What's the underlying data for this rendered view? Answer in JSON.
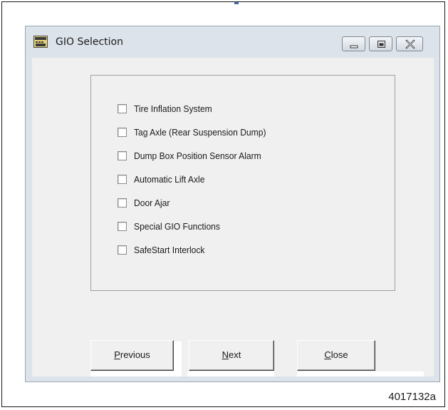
{
  "window": {
    "title": "GIO Selection",
    "icon": "app-window-icon",
    "controls": [
      "minimize-icon",
      "maximize-icon",
      "close-icon"
    ]
  },
  "options": [
    {
      "label": "Tire Inflation System",
      "checked": false
    },
    {
      "label": "Tag Axle (Rear Suspension Dump)",
      "checked": false
    },
    {
      "label": "Dump Box Position Sensor Alarm",
      "checked": false
    },
    {
      "label": "Automatic Lift Axle",
      "checked": false
    },
    {
      "label": "Door Ajar",
      "checked": false
    },
    {
      "label": "Special GIO Functions",
      "checked": false
    },
    {
      "label": "SafeStart Interlock",
      "checked": false
    }
  ],
  "buttons": {
    "previous": {
      "accel": "P",
      "rest": "revious"
    },
    "next": {
      "accel": "N",
      "rest": "ext"
    },
    "close": {
      "accel": "C",
      "rest": "lose"
    }
  },
  "figure_caption": "4017132a",
  "colors": {
    "window_frame": "#dde3ea",
    "client_bg": "#f0f0f0",
    "text": "#1a1a1a"
  }
}
